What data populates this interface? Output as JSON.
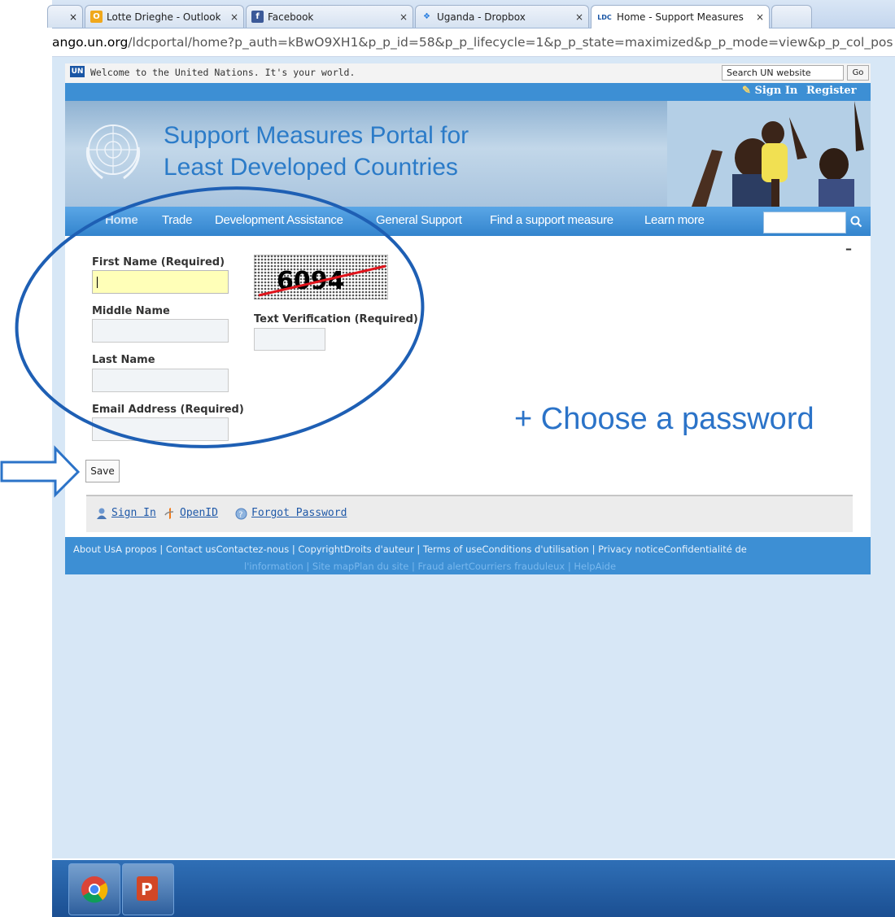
{
  "browser": {
    "tabs": [
      {
        "label": "Lotte Drieghe - Outlook W",
        "icon": "outlook-icon"
      },
      {
        "label": "Facebook",
        "icon": "facebook-icon"
      },
      {
        "label": "Uganda - Dropbox",
        "icon": "dropbox-icon"
      },
      {
        "label": "Home - Support Measures",
        "icon": "ldc-icon"
      }
    ],
    "close_glyph": "×",
    "url_domain": "ango.un.org",
    "url_path": "/ldcportal/home?p_auth=kBwO9XH1&p_p_id=58&p_p_lifecycle=1&p_p_state=maximized&p_p_mode=view&p_p_col_pos"
  },
  "un_header": {
    "logo_text": "UN",
    "welcome": "Welcome to the United Nations. It's your world.",
    "search_placeholder": "Search UN website",
    "go_label": "Go",
    "sign_in": "Sign In",
    "register": "Register"
  },
  "banner": {
    "title_line1": "Support Measures Portal for",
    "title_line2": "Least Developed Countries"
  },
  "nav": {
    "items": [
      "Home",
      "Trade",
      "Development Assistance",
      "General Support",
      "Find a support measure",
      "Learn more"
    ]
  },
  "form": {
    "first_name_label": "First Name (Required)",
    "middle_name_label": "Middle Name",
    "last_name_label": "Last Name",
    "email_label": "Email Address (Required)",
    "captcha_text": "6094",
    "verification_label": "Text Verification (Required)",
    "collapse_glyph": "–",
    "save_label": "Save"
  },
  "bottom_links": {
    "sign_in": "Sign In",
    "openid": "OpenID",
    "forgot_password": "Forgot Password"
  },
  "footer": {
    "line1": "About UsA propos   |   Contact usContactez-nous   |   CopyrightDroits d'auteur   |   Terms of useConditions d'utilisation   |   Privacy noticeConfidentialité de",
    "line2": "l'information   |   Site mapPlan du site   |   Fraud alertCourriers frauduleux   |   HelpAide"
  },
  "annotation": {
    "text": "+ Choose a password"
  },
  "colors": {
    "un_blue": "#3d8fd4",
    "title_blue": "#2b7bc8",
    "annotation_blue": "#2b73c8",
    "focus_yellow": "#ffffb8"
  }
}
